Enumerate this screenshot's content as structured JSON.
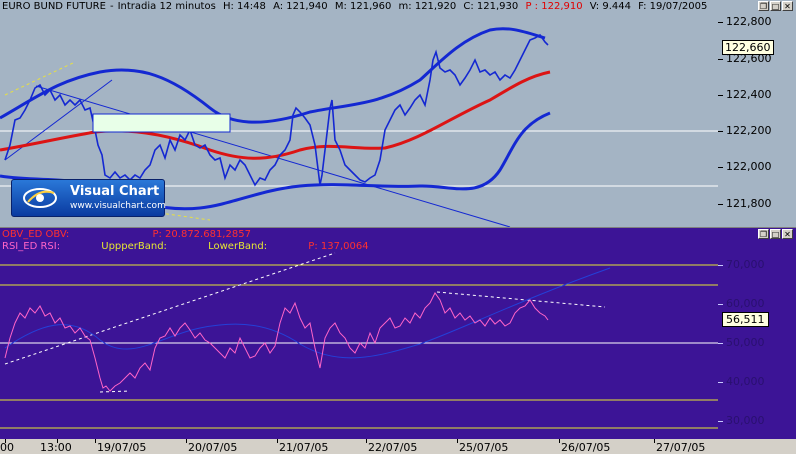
{
  "header": {
    "instrument": "EURO BUND FUTURE",
    "interval": "Intradia 12 minutos",
    "high": "H: 14:48",
    "ask": "A: 121,940",
    "max": "M: 121,960",
    "min": "m: 121,920",
    "close": "C: 121,930",
    "price": "P : 122,910",
    "volume": "V: 9.444",
    "date": "F: 19/07/2005"
  },
  "logo": {
    "name": "Visual Chart",
    "url": "www.visualchart.com"
  },
  "price_axis": {
    "labels": [
      "122,800",
      "122,600",
      "122,400",
      "122,200",
      "122,000",
      "121,800"
    ],
    "current": "122,660"
  },
  "indicator_legend": {
    "obv": "OBV_ED OBV:",
    "obv_value": "P: 20.872.681,2857",
    "rsi": "RSI_ED RSI:",
    "upper": "UppperBand:",
    "lower": "LowerBand:",
    "rsi_value": "P: 137,0064"
  },
  "rsi_axis": {
    "labels": [
      "70,000",
      "60,000",
      "50,000",
      "40,000",
      "30,000"
    ],
    "current": "56,511"
  },
  "x_axis": {
    "labels": [
      "00",
      "13:00",
      "19/07/05",
      "20/07/05",
      "21/07/05",
      "22/07/05",
      "25/07/05",
      "26/07/05",
      "27/07/05"
    ]
  },
  "colors": {
    "price_bg": "#a4b4c4",
    "indicator_bg": "#3c1496",
    "price_line": "#1428d2",
    "bollinger": "#1428d2",
    "moving_average": "#dc1414",
    "rsi_line": "#ff64c8",
    "band_lines": "#e6e632"
  },
  "window_controls": [
    "restore",
    "maximize",
    "close"
  ]
}
